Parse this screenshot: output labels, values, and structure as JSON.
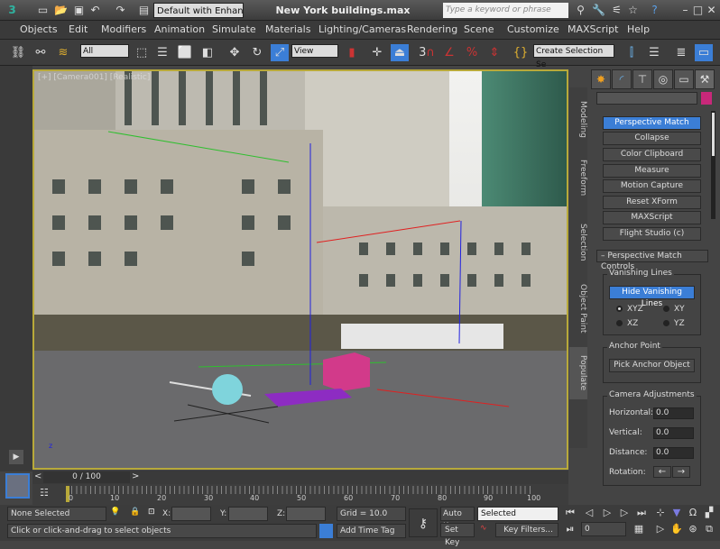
{
  "titlebar": {
    "title": "New York buildings.max",
    "workspace": "Default with Enhanc",
    "search_placeholder": "Type a keyword or phrase"
  },
  "menu": [
    "Objects",
    "Edit",
    "Modifiers",
    "Animation",
    "Simulate",
    "Materials",
    "Lighting/Cameras",
    "Rendering",
    "Scene",
    "Customize",
    "MAXScript",
    "Help"
  ],
  "toolbar": {
    "filter": "All",
    "ref_coord": "View",
    "selection_set": "Create Selection Se",
    "snap_angle": "3"
  },
  "viewport": {
    "label": "[+] [Camera001] [Realistic]"
  },
  "ribbon_tabs": [
    "Modeling",
    "Freeform",
    "Selection",
    "Object Paint",
    "Populate"
  ],
  "command_panel": {
    "swatch_color": "#c8287a",
    "utilities": [
      "Perspective Match",
      "Collapse",
      "Color Clipboard",
      "Measure",
      "Motion Capture",
      "Reset XForm",
      "MAXScript",
      "Flight Studio (c)"
    ],
    "rollout_title": "Perspective Match Controls",
    "vanishing": {
      "title": "Vanishing Lines",
      "button": "Hide Vanishing Lines",
      "options": [
        "XYZ",
        "XY",
        "XZ",
        "YZ"
      ],
      "selected": "XYZ"
    },
    "anchor": {
      "title": "Anchor Point",
      "button": "Pick Anchor Object"
    },
    "camera": {
      "title": "Camera Adjustments",
      "horizontal_label": "Horizontal:",
      "horizontal": "0.0",
      "vertical_label": "Vertical:",
      "vertical": "0.0",
      "distance_label": "Distance:",
      "distance": "0.0",
      "rotation_label": "Rotation:"
    }
  },
  "timeline": {
    "frame": "0 / 100",
    "ticks": [
      "0",
      "10",
      "20",
      "30",
      "40",
      "50",
      "60",
      "70",
      "80",
      "90",
      "100"
    ]
  },
  "status": {
    "selection": "None Selected",
    "prompt": "Click or click-and-drag to select objects",
    "x_label": "X:",
    "y_label": "Y:",
    "z_label": "Z:",
    "grid": "Grid = 10.0",
    "add_time_tag": "Add Time Tag",
    "auto_key": "Auto Key",
    "set_key": "Set Key",
    "key_mode": "Selected",
    "key_filters": "Key Filters...",
    "current_frame": "0"
  },
  "colors": {
    "accent": "#3b7ed6",
    "viewport_border": "#b8a93a"
  }
}
